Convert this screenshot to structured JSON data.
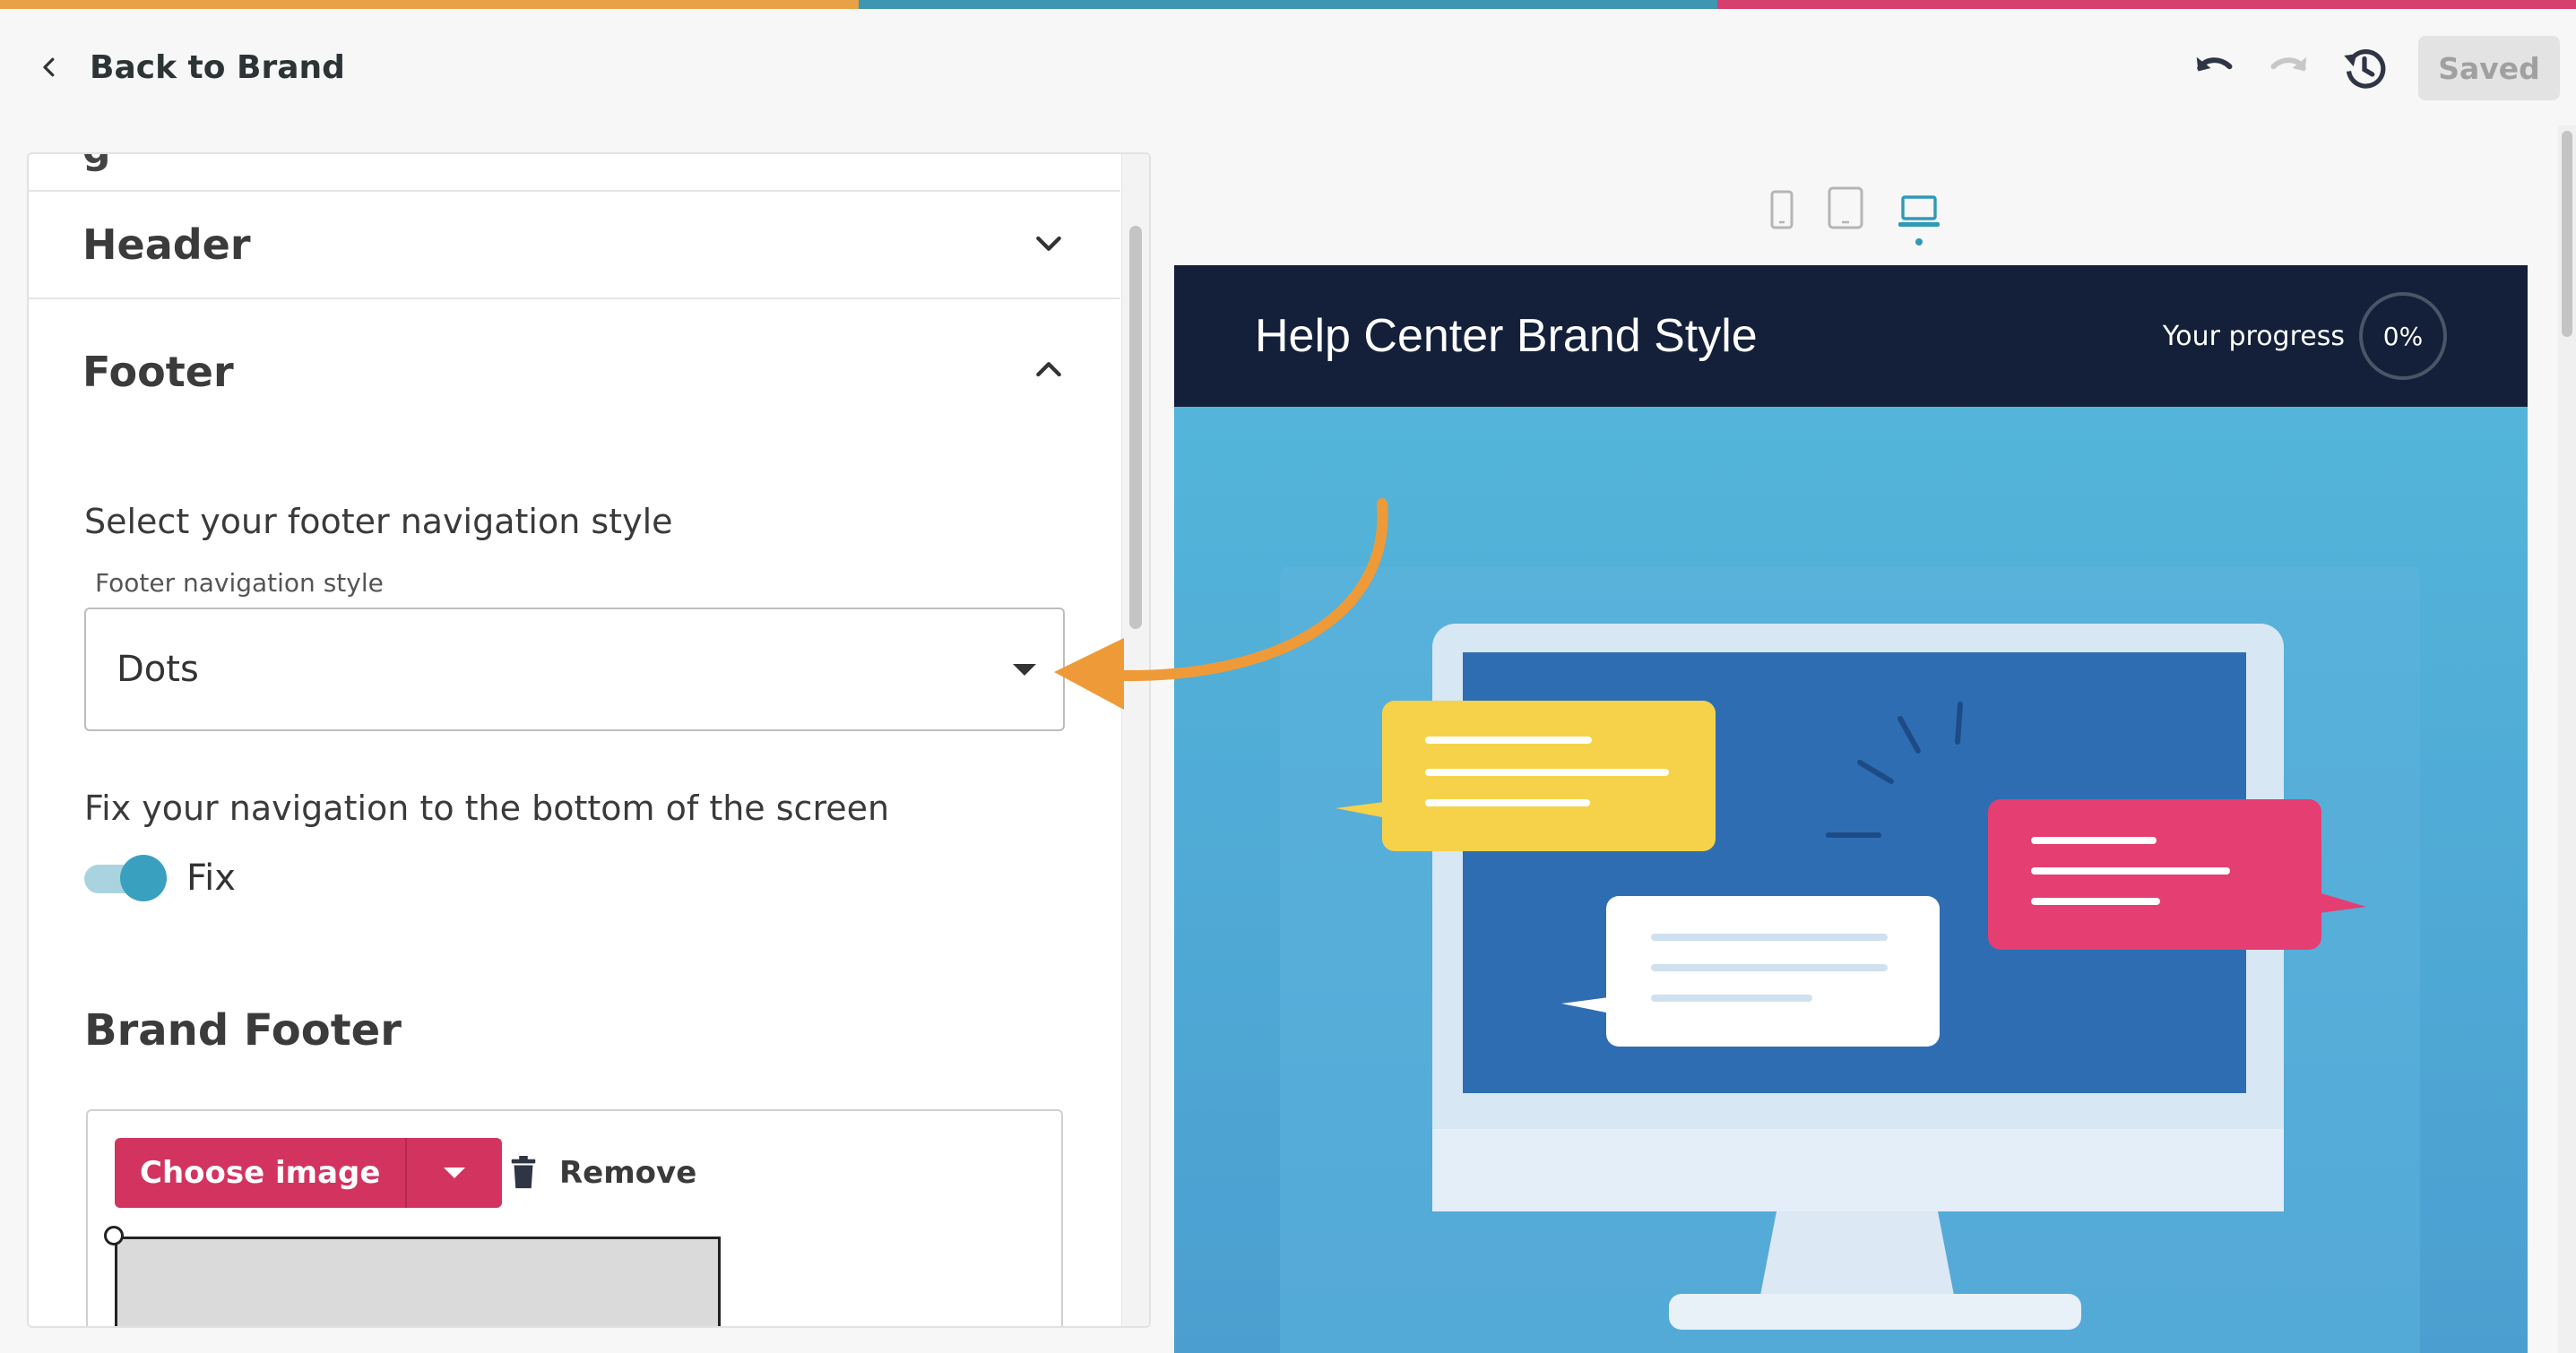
{
  "colors": {
    "stripe": [
      "#e8a245",
      "#3e96b0",
      "#d63f6e"
    ],
    "accent": "#d2345f",
    "toggle": "#3aa0c0",
    "preview_header": "#14203a",
    "preview_bg": "#55b8db",
    "callout_arrow": "#ef9a38"
  },
  "topbar": {
    "back_label": "Back to Brand",
    "back_icon": "chevron-left-icon",
    "saved_label": "Saved",
    "icons": [
      "undo-icon",
      "redo-icon",
      "history-icon"
    ]
  },
  "panel": {
    "sections": {
      "header": {
        "title": "Header",
        "expanded": false
      },
      "footer": {
        "title": "Footer",
        "expanded": true
      }
    },
    "footer": {
      "nav_prompt": "Select your footer navigation style",
      "nav_field_label": "Footer navigation style",
      "nav_value": "Dots",
      "fix_prompt": "Fix your navigation to the bottom of the screen",
      "fix_label": "Fix",
      "fix_on": true
    },
    "brand_footer": {
      "title": "Brand Footer",
      "choose_label": "Choose image",
      "remove_label": "Remove"
    }
  },
  "preview": {
    "devices": [
      "mobile-icon",
      "tablet-icon",
      "laptop-icon"
    ],
    "active_device": "laptop",
    "title": "Help Center Brand Style",
    "progress_label": "Your progress",
    "progress_value": "0%"
  }
}
